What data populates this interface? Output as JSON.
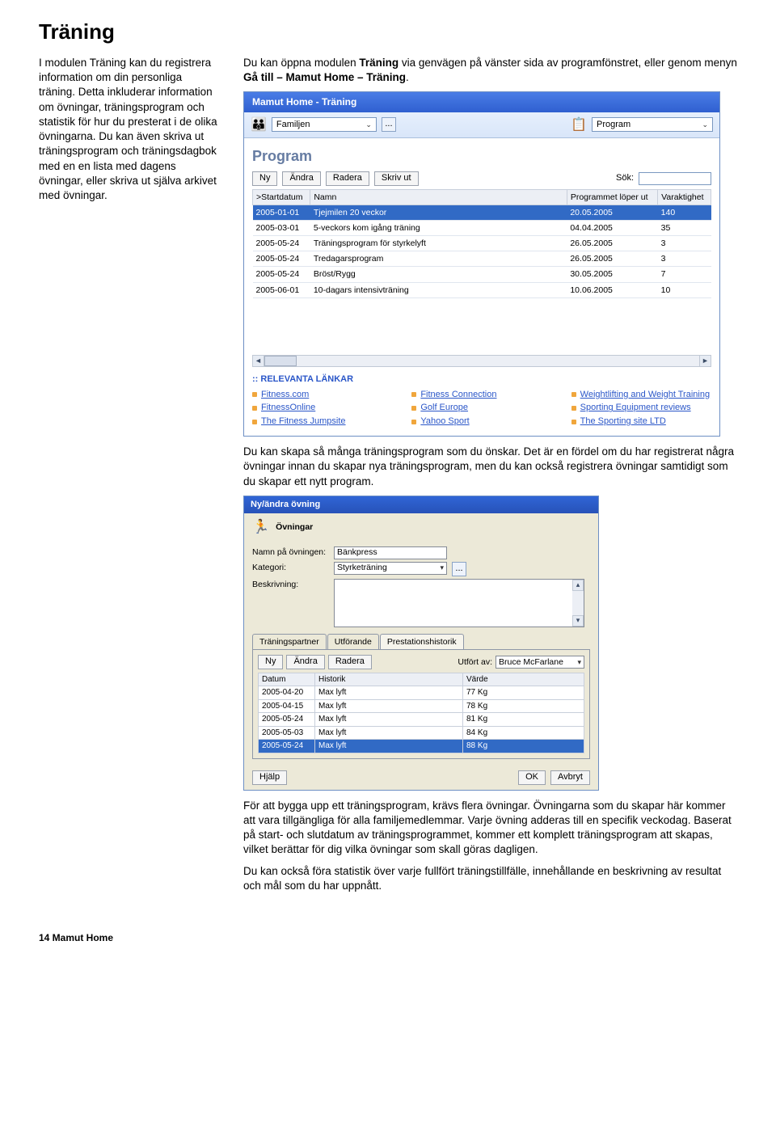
{
  "page_title": "Träning",
  "left_text": "I modulen Träning kan du registrera information om din personliga träning. Detta inkluderar information om övningar, träningsprogram och statistik för hur du presterat i de olika övningarna. Du kan även skriva ut träningsprogram och träningsdagbok med en en lista med dagens övningar, eller skriva ut själva arkivet med övningar.",
  "right_intro_parts": {
    "a": "Du kan öppna modulen ",
    "b": "Träning",
    "c": " via genvägen på vänster sida av programfönstret, eller genom menyn ",
    "d": "Gå till – Mamut Home – Träning",
    "e": "."
  },
  "mid_para": "Du kan skapa så många träningsprogram som du önskar. Det är en fördel om du har registrerat några övningar innan du skapar nya träningsprogram, men du kan också registrera övningar samtidigt som du skapar ett nytt program.",
  "end_para1": "För att bygga upp ett träningsprogram, krävs flera övningar. Övningarna som du skapar här kommer att vara tillgängliga för alla familjemedlemmar. Varje övning adderas till en specifik veckodag. Baserat på start- och slutdatum av träningsprogrammet, kommer ett komplett träningsprogram att skapas, vilket berättar för dig vilka övningar som skall göras dagligen.",
  "end_para2": "Du kan också föra statistik över varje fullfört träningstillfälle, innehållande en beskrivning av resultat och mål som du har uppnått.",
  "app": {
    "title": "Mamut Home - Träning",
    "family_dd": "Familjen",
    "browse_btn": "...",
    "program_dd": "Program",
    "section_heading": "Program",
    "buttons": {
      "ny": "Ny",
      "andra": "Ändra",
      "radera": "Radera",
      "skriv_ut": "Skriv ut"
    },
    "sok_label": "Sök:",
    "columns": {
      "start": ">Startdatum",
      "namn": "Namn",
      "loper": "Programmet löper ut",
      "varakt": "Varaktighet"
    },
    "rows": [
      {
        "d": "2005-01-01",
        "n": "Tjejmilen 20 veckor",
        "l": "20.05.2005",
        "v": "140"
      },
      {
        "d": "2005-03-01",
        "n": "5-veckors kom igång träning",
        "l": "04.04.2005",
        "v": "35"
      },
      {
        "d": "2005-05-24",
        "n": "Träningsprogram för styrkelyft",
        "l": "26.05.2005",
        "v": "3"
      },
      {
        "d": "2005-05-24",
        "n": "Tredagarsprogram",
        "l": "26.05.2005",
        "v": "3"
      },
      {
        "d": "2005-05-24",
        "n": "Bröst/Rygg",
        "l": "30.05.2005",
        "v": "7"
      },
      {
        "d": "2005-06-01",
        "n": "10-dagars intensivträning",
        "l": "10.06.2005",
        "v": "10"
      }
    ],
    "links_header": ":: RELEVANTA LÄNKAR",
    "links": [
      "Fitness.com",
      "Fitness Connection",
      "Weightlifting and Weight Training",
      "FitnessOnline",
      "Golf Europe",
      "Sporting Equipment reviews",
      "The Fitness Jumpsite",
      "Yahoo Sport",
      "The Sporting site LTD"
    ]
  },
  "dlg": {
    "title": "Ny/ändra övning",
    "heading": "Övningar",
    "labels": {
      "namn": "Namn på övningen:",
      "kategori": "Kategori:",
      "beskr": "Beskrivning:"
    },
    "values": {
      "namn": "Bänkpress",
      "kategori": "Styrketräning"
    },
    "tabs": {
      "t1": "Träningspartner",
      "t2": "Utförande",
      "t3": "Prestationshistorik"
    },
    "buttons": {
      "ny": "Ny",
      "andra": "Ändra",
      "radera": "Radera"
    },
    "utfort_label": "Utfört av:",
    "utfort_value": "Bruce McFarlane",
    "cols": {
      "d": "Datum",
      "h": "Historik",
      "v": "Värde"
    },
    "rows": [
      {
        "d": "2005-04-20",
        "h": "Max lyft",
        "v": "77 Kg"
      },
      {
        "d": "2005-04-15",
        "h": "Max lyft",
        "v": "78 Kg"
      },
      {
        "d": "2005-05-24",
        "h": "Max lyft",
        "v": "81 Kg"
      },
      {
        "d": "2005-05-03",
        "h": "Max lyft",
        "v": "84 Kg"
      },
      {
        "d": "2005-05-24",
        "h": "Max lyft",
        "v": "88 Kg"
      }
    ],
    "footer": {
      "hjalp": "Hjälp",
      "ok": "OK",
      "avbryt": "Avbryt"
    }
  },
  "page_footer": "14    Mamut Home"
}
